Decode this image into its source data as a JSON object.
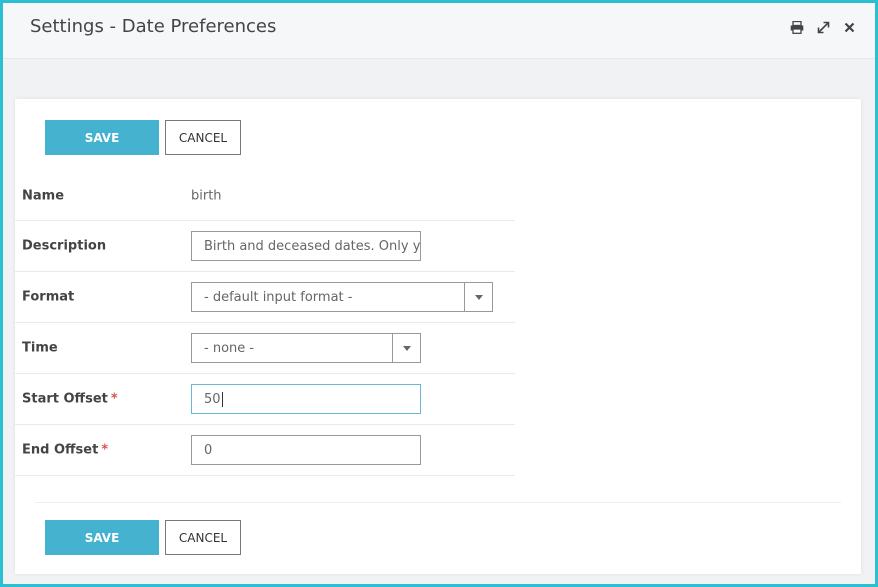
{
  "window": {
    "title": "Settings - Date Preferences",
    "icons": [
      "print-icon",
      "expand-icon",
      "close-icon"
    ]
  },
  "toolbar": {
    "save_label": "SAVE",
    "cancel_label": "CANCEL"
  },
  "form": {
    "name": {
      "label": "Name",
      "value": "birth"
    },
    "description": {
      "label": "Description",
      "value": "Birth and deceased dates. Only ye"
    },
    "format": {
      "label": "Format",
      "value": "- default input format -"
    },
    "time": {
      "label": "Time",
      "value": "- none -"
    },
    "start_offset": {
      "label": "Start Offset",
      "required": "*",
      "value": "50"
    },
    "end_offset": {
      "label": "End Offset",
      "required": "*",
      "value": "0"
    }
  },
  "colors": {
    "accent": "#45b2cf",
    "frame": "#2bbfd3",
    "required": "#d9534f"
  }
}
